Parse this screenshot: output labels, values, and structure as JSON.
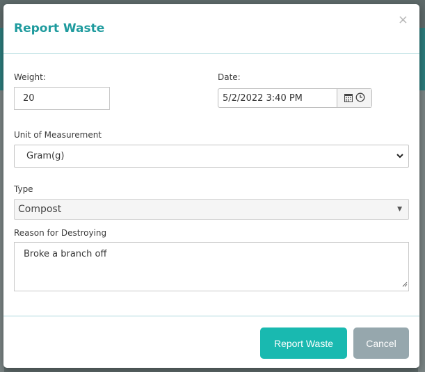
{
  "modal": {
    "title": "Report Waste",
    "close_glyph": "×"
  },
  "form": {
    "weight_label": "Weight:",
    "weight_value": "20",
    "date_label": "Date:",
    "date_value": "5/2/2022 3:40 PM",
    "unit_label": "Unit of Measurement",
    "unit_value": "Gram(g)",
    "type_label": "Type",
    "type_value": "Compost",
    "reason_label": "Reason for Destroying",
    "reason_value": "Broke a branch off"
  },
  "footer": {
    "submit_label": "Report Waste",
    "cancel_label": "Cancel"
  },
  "icons": {
    "calendar": "calendar-icon",
    "clock": "clock-icon",
    "chevron": "chevron-down-icon",
    "close": "close-icon"
  },
  "colors": {
    "title": "#1f9b9e",
    "primary_button": "#19b9b0",
    "cancel_button": "#96a7ad",
    "divider": "#a9d7db"
  }
}
